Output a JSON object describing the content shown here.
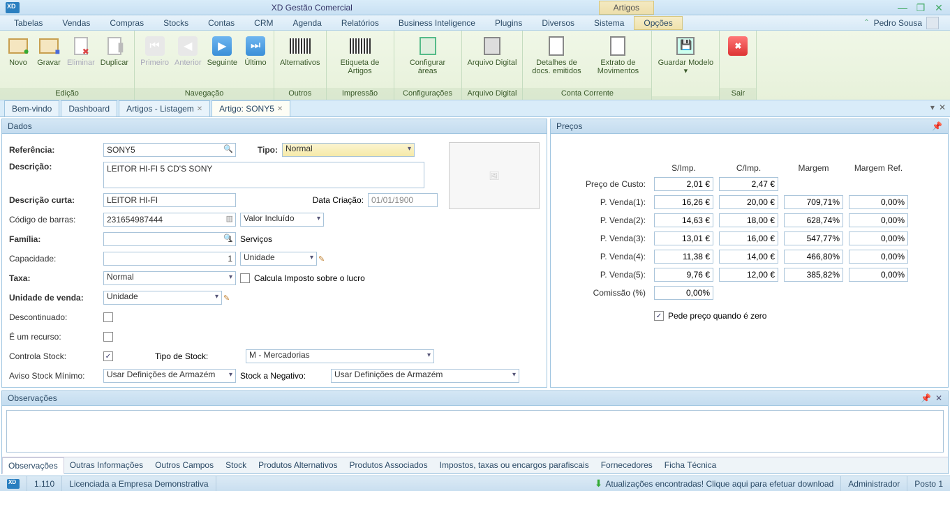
{
  "window": {
    "title": "XD Gestão Comercial",
    "section": "Artigos",
    "user": "Pedro Sousa"
  },
  "menu": {
    "items": [
      "Tabelas",
      "Vendas",
      "Compras",
      "Stocks",
      "Contas",
      "CRM",
      "Agenda",
      "Relatórios",
      "Business Inteligence",
      "Plugins",
      "Diversos",
      "Sistema",
      "Opções"
    ],
    "active": "Opções"
  },
  "ribbon": {
    "groups": [
      {
        "label": "Edição",
        "buttons": [
          {
            "key": "novo",
            "label": "Novo"
          },
          {
            "key": "gravar",
            "label": "Gravar"
          },
          {
            "key": "eliminar",
            "label": "Eliminar",
            "disabled": true
          },
          {
            "key": "duplicar",
            "label": "Duplicar"
          }
        ]
      },
      {
        "label": "Navegação",
        "buttons": [
          {
            "key": "primeiro",
            "label": "Primeiro",
            "disabled": true
          },
          {
            "key": "anterior",
            "label": "Anterior",
            "disabled": true
          },
          {
            "key": "seguinte",
            "label": "Seguinte"
          },
          {
            "key": "ultimo",
            "label": "Último"
          }
        ]
      },
      {
        "label": "Outros",
        "buttons": [
          {
            "key": "alternativos",
            "label": "Alternativos"
          }
        ]
      },
      {
        "label": "Impressão",
        "buttons": [
          {
            "key": "etiqueta",
            "label": "Etiqueta de Artigos"
          }
        ]
      },
      {
        "label": "Configurações",
        "buttons": [
          {
            "key": "conf-areas",
            "label": "Configurar áreas"
          }
        ]
      },
      {
        "label": "Arquivo Digital",
        "buttons": [
          {
            "key": "arquivo",
            "label": "Arquivo Digital"
          }
        ]
      },
      {
        "label": "Conta Corrente",
        "buttons": [
          {
            "key": "detalhes",
            "label": "Detalhes de docs. emitidos"
          },
          {
            "key": "extrato",
            "label": "Extrato de Movimentos"
          }
        ]
      },
      {
        "label": "",
        "buttons": [
          {
            "key": "guardar-modelo",
            "label": "Guardar Modelo ▾"
          }
        ]
      },
      {
        "label": "Sair",
        "buttons": [
          {
            "key": "sair",
            "label": ""
          }
        ]
      }
    ]
  },
  "doc_tabs": {
    "tabs": [
      {
        "label": "Bem-vindo",
        "closable": false
      },
      {
        "label": "Dashboard",
        "closable": false
      },
      {
        "label": "Artigos - Listagem",
        "closable": true
      },
      {
        "label": "Artigo: SONY5",
        "closable": true,
        "active": true
      }
    ]
  },
  "dados": {
    "title": "Dados",
    "labels": {
      "referencia": "Referência:",
      "tipo": "Tipo:",
      "descricao": "Descrição:",
      "descricao_curta": "Descrição curta:",
      "data_criacao": "Data Criação:",
      "codigo_barras": "Código de barras:",
      "familia": "Família:",
      "capacidade": "Capacidade:",
      "taxa": "Taxa:",
      "calcula_imposto": "Calcula Imposto sobre o lucro",
      "unidade_venda": "Unidade de venda:",
      "descontinuado": "Descontinuado:",
      "e_recurso": "É um recurso:",
      "controla_stock": "Controla Stock:",
      "tipo_stock": "Tipo de Stock:",
      "aviso_stock": "Aviso Stock Mínimo:",
      "stock_negativo": "Stock a Negativo:"
    },
    "values": {
      "referencia": "SONY5",
      "tipo": "Normal",
      "descricao": "LEITOR HI-FI 5 CD'S SONY",
      "descricao_curta": "LEITOR HI-FI",
      "data_criacao": "01/01/1900",
      "codigo_barras": "231654987444",
      "codigo_barras_mode": "Valor Incluído",
      "familia": "1",
      "familia_desc": "Serviços",
      "capacidade": "1",
      "capacidade_un": "Unidade",
      "taxa": "Normal",
      "calcula_imposto": false,
      "unidade_venda": "Unidade",
      "descontinuado": false,
      "e_recurso": false,
      "controla_stock": true,
      "tipo_stock": "M - Mercadorias",
      "aviso_stock": "Usar Definições de Armazém",
      "stock_negativo": "Usar Definições de Armazém"
    }
  },
  "precos": {
    "title": "Preços",
    "headers": {
      "simp": "S/Imp.",
      "cimp": "C/Imp.",
      "margem": "Margem",
      "margem_ref": "Margem Ref."
    },
    "labels": {
      "custo": "Preço de Custo:",
      "pv1": "P. Venda(1):",
      "pv2": "P. Venda(2):",
      "pv3": "P. Venda(3):",
      "pv4": "P. Venda(4):",
      "pv5": "P. Venda(5):",
      "comissao": "Comissão (%)",
      "pede_preco": "Pede preço quando é zero"
    },
    "rows": {
      "custo": {
        "simp": "2,01 €",
        "cimp": "2,47 €"
      },
      "pv1": {
        "simp": "16,26 €",
        "cimp": "20,00 €",
        "margem": "709,71%",
        "mref": "0,00%"
      },
      "pv2": {
        "simp": "14,63 €",
        "cimp": "18,00 €",
        "margem": "628,74%",
        "mref": "0,00%"
      },
      "pv3": {
        "simp": "13,01 €",
        "cimp": "16,00 €",
        "margem": "547,77%",
        "mref": "0,00%"
      },
      "pv4": {
        "simp": "11,38 €",
        "cimp": "14,00 €",
        "margem": "466,80%",
        "mref": "0,00%"
      },
      "pv5": {
        "simp": "9,76 €",
        "cimp": "12,00 €",
        "margem": "385,82%",
        "mref": "0,00%"
      },
      "comissao": "0,00%"
    },
    "pede_preco": true
  },
  "obs": {
    "title": "Observações",
    "bottom_tabs": [
      "Observações",
      "Outras Informações",
      "Outros Campos",
      "Stock",
      "Produtos Alternativos",
      "Produtos Associados",
      "Impostos, taxas ou encargos parafiscais",
      "Fornecedores",
      "Ficha Técnica"
    ],
    "active_tab": "Observações"
  },
  "status": {
    "version": "1.110",
    "license": "Licenciada a Empresa Demonstrativa",
    "update": "Atualizações encontradas! Clique aqui para efetuar download",
    "admin": "Administrador",
    "posto": "Posto 1"
  }
}
